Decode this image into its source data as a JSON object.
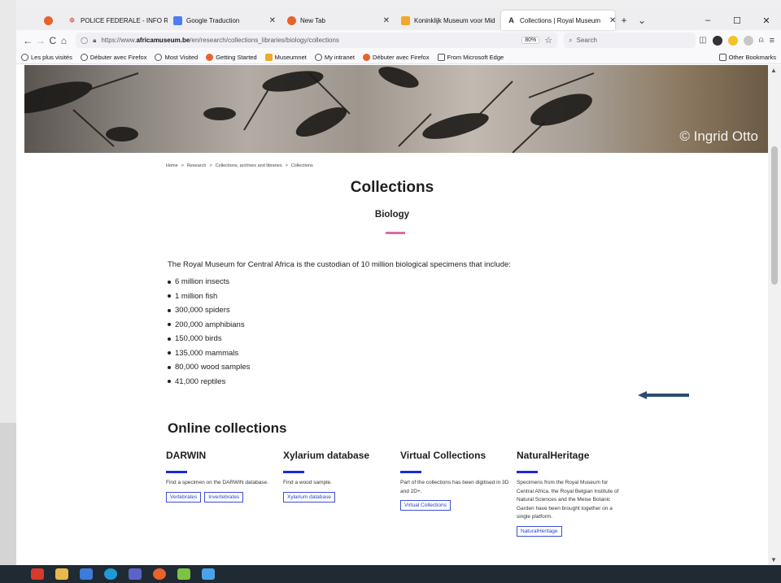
{
  "browser": {
    "tabs": [
      {
        "label": "POLICE FEDERALE - INFO RO",
        "close": "✕"
      },
      {
        "label": "Google Traduction",
        "close": "✕"
      },
      {
        "label": "New Tab",
        "close": "✕"
      },
      {
        "label": "Koninklijk Museum voor Mid",
        "close": "✕"
      },
      {
        "label": "Collections | Royal Museum",
        "close": "✕"
      }
    ],
    "new_tab": "+",
    "tab_list": "⌄",
    "window_controls": {
      "minimize": "–",
      "maximize": "☐",
      "close": "✕"
    },
    "nav": {
      "back": "←",
      "forward": "→",
      "reload": "C",
      "home": "⌂"
    },
    "url_prefix": "https://www.",
    "url_host": "africamuseum.be",
    "url_path": "/en/research/collections_libraries/biology/collections",
    "zoom": "80%",
    "search_placeholder": "Search",
    "bookmarks": [
      "Les plus visités",
      "Débuter avec Firefox",
      "Most Visited",
      "Getting Started",
      "Museumnet",
      "My intranet",
      "Débuter avec Firefox",
      "From Microsoft Edge"
    ],
    "other_bookmarks": "Other Bookmarks"
  },
  "page": {
    "banner_credit": "© Ingrid Otto",
    "breadcrumb": [
      "Home",
      ">",
      "Research",
      ">",
      "Collections, archives and libraries",
      ">",
      "Collections"
    ],
    "title": "Collections",
    "subtitle": "Biology",
    "intro": "The Royal Museum for Central Africa is the custodian of 10 million biological specimens that include:",
    "specimens": [
      "6 million insects",
      "1 million fish",
      "300,000 spiders",
      "200,000 amphibians",
      "150,000 birds",
      "135,000 mammals",
      "80,000 wood samples",
      "41,000 reptiles"
    ],
    "online_title": "Online collections",
    "collections": [
      {
        "title": "DARWIN",
        "desc": "Find a specimen on the DARWIN database.",
        "links": [
          "Vertebrates",
          "Invertebrates"
        ]
      },
      {
        "title": "Xylarium database",
        "desc": "Find a wood sample.",
        "links": [
          "Xylarium database"
        ]
      },
      {
        "title": "Virtual Collections",
        "desc": "Part of the collections has been digitised in 3D and 2D+.",
        "links": [
          "Virtual Collections"
        ]
      },
      {
        "title": "NaturalHeritage",
        "desc": "Specimens from the Royal Museum for Central Africa, the Royal Belgian Institute of Natural Sciences and the Meise Botanic Garden have been brought together on a single platform.",
        "links": [
          "NaturalHeritage"
        ]
      }
    ]
  },
  "colors": {
    "accent_pink": "#e06a9f",
    "accent_blue": "#1a2bd6",
    "arrow": "#2c4e6e"
  }
}
